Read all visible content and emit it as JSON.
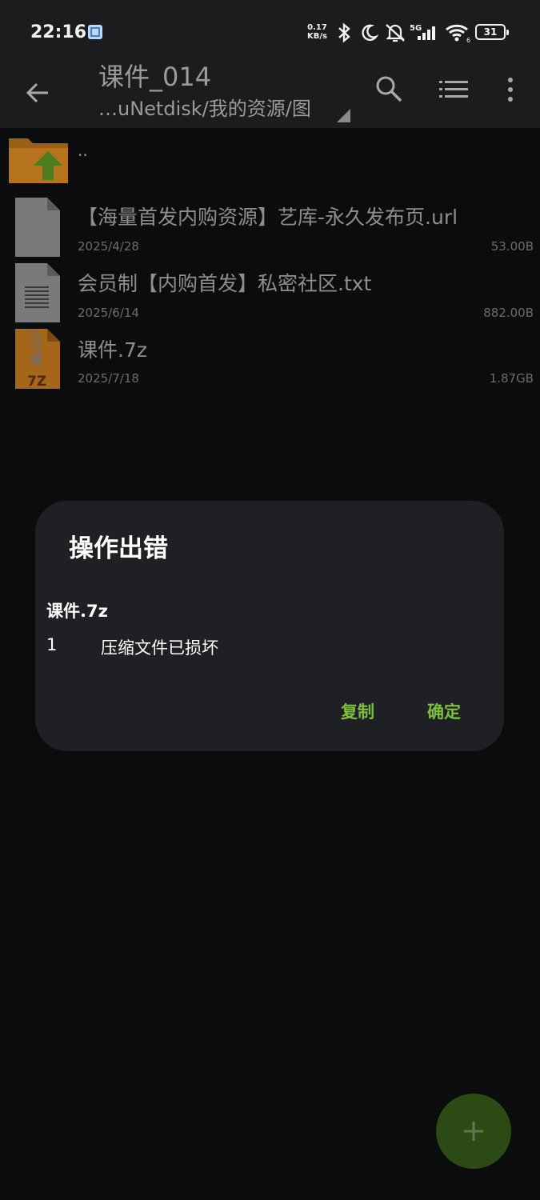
{
  "status_bar": {
    "time": "22:16",
    "net_speed_value": "0.17",
    "net_speed_unit": "KB/s",
    "network": "5G",
    "wifi_level": "6",
    "battery": "31"
  },
  "toolbar": {
    "title": "课件_014",
    "path": "…uNetdisk/我的资源/图"
  },
  "parent_row": {
    "label": ".."
  },
  "files": [
    {
      "name": "【海量首发内购资源】艺库-永久发布页.url",
      "date": "2025/4/28",
      "size": "53.00B",
      "icon": "file-icon"
    },
    {
      "name": "会员制【内购首发】私密社区.txt",
      "date": "2025/6/14",
      "size": "882.00B",
      "icon": "text-file-icon"
    },
    {
      "name": "课件.7z",
      "date": "2025/7/18",
      "size": "1.87GB",
      "icon": "archive-icon",
      "icon_label": "7Z"
    }
  ],
  "dialog": {
    "title": "操作出错",
    "file": "课件.7z",
    "error_index": "1",
    "error_message": "压缩文件已损坏",
    "copy_label": "复制",
    "ok_label": "确定"
  },
  "colors": {
    "accent": "#7bbf3c",
    "fab": "#2c4a14",
    "background": "#0b0c0e",
    "bar": "#1b1c1e",
    "dialog": "#1f2024"
  }
}
